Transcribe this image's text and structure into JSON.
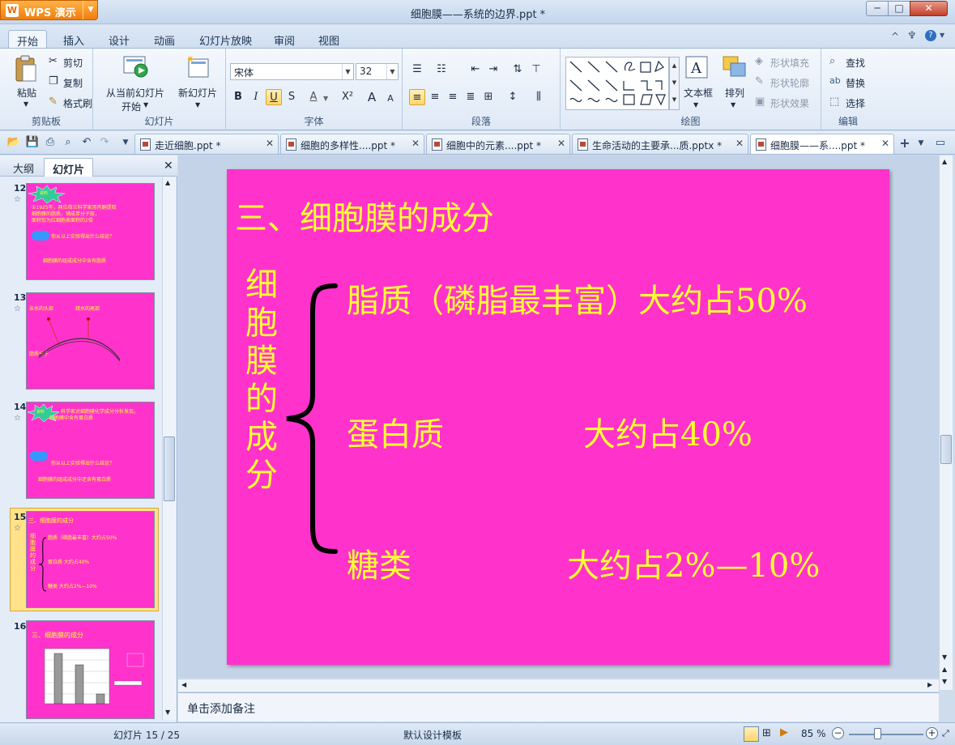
{
  "app": {
    "name": "WPS 演示",
    "window_title": "细胞膜——系统的边界.ppt *"
  },
  "window_controls": {
    "minimize": "─",
    "maximize": "□",
    "close": "✕"
  },
  "ribbon_tabs": [
    "开始",
    "插入",
    "设计",
    "动画",
    "幻灯片放映",
    "审阅",
    "视图"
  ],
  "ribbon_right": {
    "collapse": "^",
    "skin": "♆",
    "help": "?"
  },
  "clipboard": {
    "paste": "粘贴",
    "cut": "剪切",
    "copy": "复制",
    "format_painter": "格式刷",
    "title": "剪贴板"
  },
  "slides_group": {
    "from_current": "从当前幻灯片",
    "start": "开始",
    "new_slide": "新幻灯片",
    "title": "幻灯片"
  },
  "font_group": {
    "font_name": "宋体",
    "font_size": "32",
    "title": "字体",
    "bold": "B",
    "italic": "I",
    "underline": "U",
    "shadow": "S",
    "color": "A",
    "superscript": "X²",
    "grow": "A",
    "shrink": "A"
  },
  "paragraph_group": {
    "title": "段落"
  },
  "drawing_group": {
    "textbox": "文本框",
    "arrange": "排列",
    "fill": "形状填充",
    "outline": "形状轮廓",
    "effects": "形状效果",
    "title": "绘图"
  },
  "editing_group": {
    "find": "查找",
    "replace": "替换",
    "select": "选择",
    "title": "编辑"
  },
  "doc_tabs": [
    {
      "label": "走近细胞.ppt *"
    },
    {
      "label": "细胞的多样性....ppt *"
    },
    {
      "label": "细胞中的元素....ppt *"
    },
    {
      "label": "生命活动的主要承...质.pptx *"
    },
    {
      "label": "细胞膜——系....ppt *"
    }
  ],
  "left_panel": {
    "tab_outline": "大纲",
    "tab_slides": "幻灯片",
    "close": "✕"
  },
  "thumbnails": [
    {
      "num": "12",
      "lines": [
        "资料",
        "①1925年，两位荷兰科学家用丙酮提取",
        "细胞膜的脂质，铺成单分子层，",
        "面积恰为红细胞表面积的2倍",
        "你从以上实验得出什么结论？",
        "细胞膜的组成成分中含有脂质"
      ]
    },
    {
      "num": "13",
      "lines": [
        "亲水的头部",
        "疏水的尾部",
        "脂质分子"
      ]
    },
    {
      "num": "14",
      "lines": [
        "资料",
        "科学家对细胞膜化学成分分析发现，",
        "细胞膜中含有蛋白质",
        "你从以上实验得出什么结论？",
        "细胞膜的组成成分中还含有蛋白质"
      ]
    },
    {
      "num": "15",
      "lines": [
        "三、细胞膜的成分",
        "脂质（磷脂最丰富）大约占50%",
        "蛋白质          大约占40%",
        "糖类           大约占2%—10%",
        "细胞膜的成分"
      ]
    },
    {
      "num": "16",
      "lines": [
        "三、细胞膜的成分"
      ]
    }
  ],
  "slide": {
    "title": "三、细胞膜的成分",
    "side_label": "细胞膜的成分",
    "rows": [
      {
        "name": "脂质（磷脂最丰富）大约占50%",
        "amount": ""
      },
      {
        "name": "蛋白质",
        "amount": "大约占40%"
      },
      {
        "name": "糖类",
        "amount": "大约占2%—10%"
      }
    ]
  },
  "notes_placeholder": "单击添加备注",
  "status": {
    "slide_counter": "幻灯片 15 / 25",
    "template": "默认设计模板",
    "zoom": "85 %"
  },
  "colors": {
    "slide_bg": "#ff33cc",
    "slide_text": "#ffff33",
    "ribbon_bg": "#dfe9f6",
    "app_button": "#f07d0c"
  }
}
